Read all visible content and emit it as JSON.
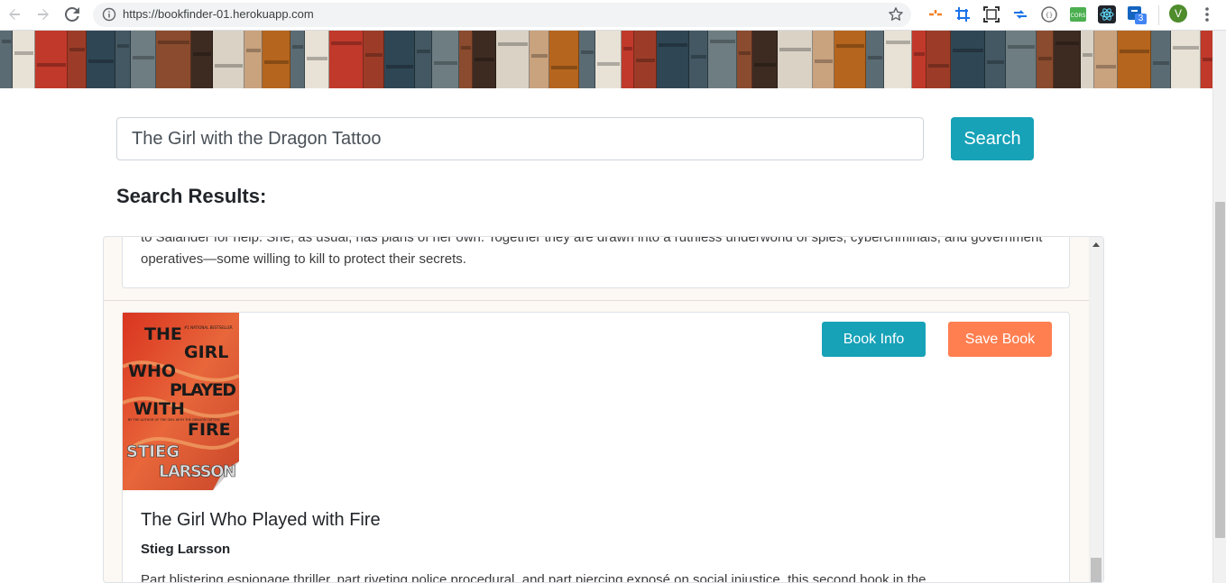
{
  "browser": {
    "url": "https://bookfinder-01.herokuapp.com",
    "avatar_letter": "V",
    "extension_badge": "3",
    "extensions": [
      "frame-icon",
      "crop-icon",
      "screenshot-icon",
      "arrows-icon",
      "code-icon",
      "cors-icon",
      "react-icon",
      "notes-icon"
    ]
  },
  "search": {
    "value": "The Girl with the Dragon Tattoo",
    "button_label": "Search"
  },
  "results": {
    "heading": "Search Results:",
    "previous_card": {
      "description_tail": "to Salander for help. She, as usual, has plans of her own. Together they are drawn into a ruthless underworld of spies, cybercriminals, and government operatives—some willing to kill to protect their secrets."
    },
    "book": {
      "cover_lines": [
        "THE",
        "GIRL",
        "WHO",
        "PLAYED",
        "WITH",
        "FIRE",
        "STIEG",
        "LARSSON"
      ],
      "cover_badge": "#1 NATIONAL BESTSELLER",
      "cover_note": "BY THE AUTHOR OF THE GIRL WITH THE DRAGON TATTOO",
      "title": "The Girl Who Played with Fire",
      "author": "Stieg Larsson",
      "description": "Part blistering espionage thriller, part riveting police procedural, and part piercing exposé on social injustice, this second book in the",
      "info_label": "Book Info",
      "save_label": "Save Book"
    }
  },
  "colors": {
    "primary": "#17a2b8",
    "save": "#ff7f50",
    "panel_bg": "#fcf8f3"
  }
}
